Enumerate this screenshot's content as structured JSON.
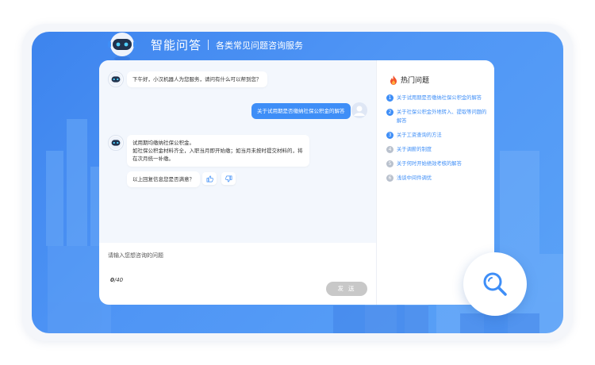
{
  "header": {
    "title": "智能问答",
    "subtitle": "各类常见问题咨询服务"
  },
  "chat": {
    "greeting": "下午好，小汉机器人为您服务，请问有什么可以帮到您？",
    "user_question": "关于试用期是否缴纳社保公积金的解答",
    "answer_line1": "试用期均缴纳社保公积金。",
    "answer_line2": "如社保公积金材料齐全，入职当月即开始缴；如当月未按时提交材料的，将",
    "answer_line3": "在次月统一补缴。",
    "feedback_prompt": "以上回复信息您是否满意？",
    "input_placeholder": "请输入您想咨询的问题",
    "count_current": "0",
    "count_max": "/40",
    "send_label": "发 送"
  },
  "hot": {
    "title": "热门问题",
    "items": [
      {
        "num": "1",
        "text": "关于试用期是否缴纳社保公积金的解答"
      },
      {
        "num": "2",
        "text": "关于社保公积金外地转入、提取等问题的解答"
      },
      {
        "num": "3",
        "text": "关于工资查询的方法"
      },
      {
        "num": "4",
        "text": "关于调薪的制度"
      },
      {
        "num": "5",
        "text": "关于何时开始绩效考核的解答"
      },
      {
        "num": "6",
        "text": "浅谈中间件调优"
      }
    ]
  },
  "colors": {
    "accent": "#3e8ef7",
    "background_blue": "#4a8ff2",
    "send_disabled": "#c8c8c8"
  }
}
